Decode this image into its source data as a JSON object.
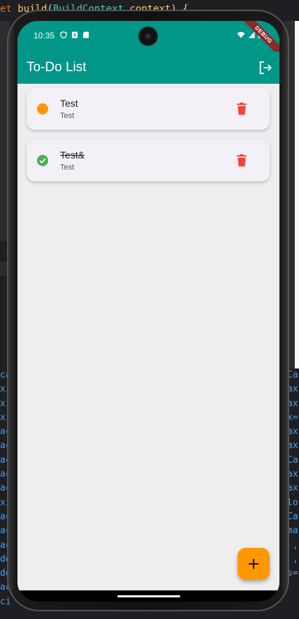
{
  "ide": {
    "top_line": [
      "et ",
      "build",
      "(",
      "BuildContext",
      " context",
      ") {"
    ],
    "left_lines": "ca\nxi\nxi\nxi\nac\nac\nac\nac\nac\nxi\nac\nac\nac\ndo\ndo\nac\nci",
    "right_lines": "Ca\nax\nax\nx=\nax\nax\nCa\nax\nax\nlo\nCa\nma\n ,\n ,\ns=",
    "colors": {
      "keyword": "#cc7832",
      "function": "#ffc66d",
      "type": "#4ec9b0"
    }
  },
  "status_bar": {
    "time": "10:35",
    "left_icons": [
      "shield-icon",
      "sim-a-icon",
      "sd-card-icon"
    ],
    "right_icons": [
      "wifi-icon",
      "signal-icon",
      "battery-icon"
    ],
    "debug_label": "DEBUG",
    "color": "#009688"
  },
  "app_bar": {
    "title": "To-Do List",
    "action_icon": "logout-icon"
  },
  "tasks": [
    {
      "title": "Test",
      "subtitle": "Test",
      "completed": false,
      "status_icon": "pending-dot-icon",
      "status_color": "#ff9800",
      "delete_icon": "trash-icon"
    },
    {
      "title": "Test&",
      "subtitle": "Test",
      "completed": true,
      "status_icon": "check-circle-icon",
      "status_color": "#4caf50",
      "delete_icon": "trash-icon"
    }
  ],
  "fab": {
    "icon": "plus-icon",
    "color": "#ff9800"
  },
  "colors": {
    "primary": "#009688",
    "accent": "#ff9800",
    "danger": "#f44336",
    "card": "#f4f0f7",
    "background": "#eeeeee"
  }
}
